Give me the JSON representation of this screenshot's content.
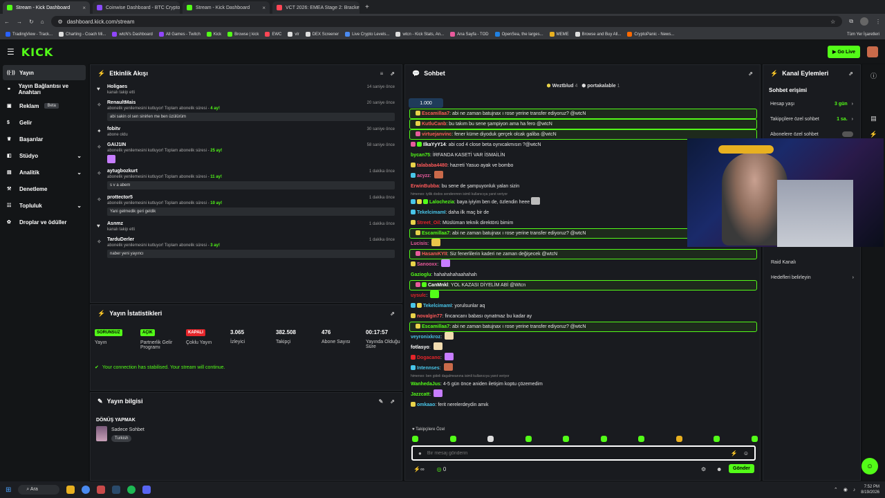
{
  "browser": {
    "tabs": [
      {
        "label": "Stream - Kick Dashboard",
        "color": "#53fc18",
        "active": true
      },
      {
        "label": "Coinwise Dashboard - BTC Crypto",
        "color": "#8a4bff",
        "active": false
      },
      {
        "label": "Stream - Kick Dashboard",
        "color": "#53fc18",
        "active": false
      },
      {
        "label": "VCT 2026: EMEA Stage 2: Brackets",
        "color": "#ff4655",
        "active": false
      }
    ],
    "url": "dashboard.kick.com/stream",
    "bookmarks": [
      "TradingView - Track...",
      "Charting - Coach Mi...",
      "wtcN's Dashboard",
      "All Games - Twitch",
      "Kick",
      "Browse | kick",
      "EWC",
      "vlr",
      "DEX Screener",
      "Live Crypto Levels...",
      "wtcn - Kick Stats, An...",
      "Ana Sayfa - TOD",
      "OpenSea, the larges...",
      "MEME",
      "Browse and Buy All...",
      "CryptoPanic - News..."
    ],
    "bookmarks_all": "Tüm Yer İşaretleri"
  },
  "header": {
    "logo": "KICK",
    "go_live": "Go Live"
  },
  "sidebar": {
    "items": [
      {
        "label": "Yayın",
        "icon": "broadcast-icon",
        "active": true,
        "chevron": false
      },
      {
        "label": "Yayın Bağlantısı ve Anahtarı",
        "icon": "link-icon",
        "active": false,
        "chevron": false
      },
      {
        "label": "Reklam",
        "icon": "ad-icon",
        "active": false,
        "chevron": false,
        "badge": "Beta"
      },
      {
        "label": "Gelir",
        "icon": "money-icon",
        "active": false,
        "chevron": false
      },
      {
        "label": "Başarılar",
        "icon": "trophy-icon",
        "active": false,
        "chevron": false
      },
      {
        "label": "Stüdyo",
        "icon": "studio-icon",
        "active": false,
        "chevron": true
      },
      {
        "label": "Analitik",
        "icon": "chart-icon",
        "active": false,
        "chevron": true
      },
      {
        "label": "Denetleme",
        "icon": "gavel-icon",
        "active": false,
        "chevron": false
      },
      {
        "label": "Topluluk",
        "icon": "community-icon",
        "active": false,
        "chevron": true
      },
      {
        "label": "Droplar ve ödüller",
        "icon": "gift-icon",
        "active": false,
        "chevron": false
      }
    ]
  },
  "activity": {
    "title": "Etkinlik Akışı",
    "items": [
      {
        "name": "Holigaes",
        "time": "14 saniye önce",
        "sub": "kanalı takip etti",
        "icon": "♥"
      },
      {
        "name": "RenaultMais",
        "time": "20 saniye önce",
        "sub": "abonelik yenilemesini kutluyor! Toplam abonelik süresi - ",
        "months": "4 ay!",
        "msg": "abi sakin ol sen sinirlen me ben üzülürüm",
        "icon": "✧"
      },
      {
        "name": "fobitv",
        "time": "30 saniye önce",
        "sub": "abone oldu",
        "icon": "✦"
      },
      {
        "name": "GAIJ1IN",
        "time": "58 saniye önce",
        "sub": "abonelik yenilemesini kutluyor! Toplam abonelik süresi - ",
        "months": "25 ay!",
        "emote": true,
        "icon": "✧"
      },
      {
        "name": "aytugbozkurt",
        "time": "1 dakika önce",
        "sub": "abonelik yenilemesini kutluyor! Toplam abonelik süresi - ",
        "months": "11 ay!",
        "msg": "s v a abem",
        "icon": "✧"
      },
      {
        "name": "prottector5",
        "time": "1 dakika önce",
        "sub": "abonelik yenilemesini kutluyor! Toplam abonelik süresi - ",
        "months": "10 ay!",
        "msg": "Yani gelmedik geri geldik",
        "icon": "✧"
      },
      {
        "name": "Asnmz",
        "time": "1 dakika önce",
        "sub": "kanalı takip etti",
        "icon": "♥"
      },
      {
        "name": "TarduDerler",
        "time": "1 dakika önce",
        "sub": "abonelik yenilemesini kutluyor! Toplam abonelik süresi - ",
        "months": "3 ay!",
        "msg": "naber yeni yayıncı",
        "icon": "✧"
      }
    ]
  },
  "stats": {
    "title": "Yayın İstatistikleri",
    "cols": [
      {
        "top": "SORUNSUZ",
        "label": "Yayın",
        "pill": "#53fc18"
      },
      {
        "top": "AÇIK",
        "label": "Partnerlik Gelir Programı",
        "pill": "#53fc18"
      },
      {
        "top": "KAPALI",
        "label": "Çoklu Yayın",
        "pill": "#e5252a"
      },
      {
        "top": "3.065",
        "label": "İzleyici"
      },
      {
        "top": "382.508",
        "label": "Takipçi"
      },
      {
        "top": "476",
        "label": "Abone Sayısı"
      },
      {
        "top": "00:17:57",
        "label": "Yayında Olduğu Süre"
      }
    ],
    "notice": "Your connection has stabilised. Your stream will continue."
  },
  "info": {
    "title": "Yayın bilgisi",
    "stream_title": "DÖNÜŞ YAPMAK",
    "category": "Sadece Sohbet",
    "lang": "Turkish"
  },
  "chat": {
    "title": "Sohbet",
    "mods": [
      {
        "name": "Weztblud",
        "count": "4"
      },
      {
        "name": "portakalable",
        "count": "1"
      }
    ],
    "goal": "1.000",
    "lines": [
      {
        "user": "Escamillaa7",
        "color": "#ff5a5a",
        "text": "abi ne zaman batujnax ı rose yerine transfer ediyoruz? @wtcN",
        "hl": true,
        "b": [
          "#e8d24a"
        ]
      },
      {
        "user": "KutluCanb",
        "color": "#ff5a5a",
        "text": "bu takım bu sene şampiyon ama ha fero @wtcN",
        "hl": true,
        "b": [
          "#e8d24a"
        ]
      },
      {
        "user": "virtuejanvinc",
        "color": "#ff5a5a",
        "text": "fener küme diyoduk gerçek olcak galiba @wtcN",
        "hl": true,
        "b": [
          "#e85a9c"
        ]
      },
      {
        "user": "IlkaYyY14",
        "color": "#ffffff",
        "text": "abi cod 4 close beta oynıcakmısın ?@wtcN",
        "hl": false,
        "b": [
          "#e85a9c",
          "#53fc18"
        ]
      },
      {
        "user": "bycan75",
        "color": "#53fc18",
        "text": "İRFANDA KASETİ VAR İSMAİLİN",
        "hl": false,
        "b": []
      },
      {
        "user": "talababa4480",
        "color": "#ff5a5a",
        "text": "hazreti Yasuo ayak ve bombo",
        "hl": false,
        "b": [
          "#e8d24a"
        ]
      },
      {
        "user": "acyzz",
        "color": "#e85a9c",
        "text": "",
        "hl": false,
        "b": [
          "#49c5e8"
        ],
        "emote": "#c96a4a"
      },
      {
        "user": "ErwinBubba",
        "color": "#ff5a5a",
        "text": "bu sene de şampuyonluk yalan sizin",
        "hl": false,
        "b": []
      },
      {
        "sys": "himenoo: iyilik dodos sendenmnn isimli kullanıcıya yanıt veriyor"
      },
      {
        "user": "Lalochezia",
        "color": "#53fc18",
        "text": "baya iyiyim ben de, özlendin heee",
        "hl": false,
        "b": [
          "#49c5e8",
          "#e8d24a",
          "#53fc18"
        ],
        "emote": "#bbb"
      },
      {
        "user": "TekelcimamI",
        "color": "#49c5e8",
        "text": "daha ilk maç bir de",
        "hl": false,
        "b": [
          "#49c5e8"
        ]
      },
      {
        "user": "Street_Oil",
        "color": "#e5252a",
        "text": "Müslüman teknik direktörü bimim",
        "hl": false,
        "b": [
          "#e8d24a"
        ]
      },
      {
        "user": "Escamillaa7",
        "color": "#53fc18",
        "text": "abi ne zaman batujnax ı rose yerine transfer ediyoruz? @wtcN",
        "hl": true,
        "b": [
          "#e8d24a"
        ]
      },
      {
        "user": "Lucisis",
        "color": "#e85a9c",
        "text": "",
        "hl": false,
        "b": [],
        "emote": "#e8c44a"
      },
      {
        "user": "HasanıKYII",
        "color": "#ff5a5a",
        "text": "Siz fenerlilerin kaderi ne zaman değişecek @wtcN",
        "hl": true,
        "b": [
          "#e85a9c"
        ]
      },
      {
        "user": "Sanooxx",
        "color": "#e85a9c",
        "text": "",
        "hl": false,
        "b": [
          "#e8d24a"
        ],
        "emote": "#c77dff"
      },
      {
        "user": "Gazioglu",
        "color": "#53fc18",
        "text": "hahahahahaahahah",
        "hl": false,
        "b": []
      },
      {
        "user": "CanMnkl",
        "color": "#ffffff",
        "text": "YOL KAZASI DİYELİM ABİ @Wtcn",
        "hl": true,
        "b": [
          "#e85a9c",
          "#53fc18"
        ]
      },
      {
        "user": "uysulc",
        "color": "#e5252a",
        "text": "",
        "hl": false,
        "b": [],
        "emote": "#53fc18"
      },
      {
        "user": "TekelcimamI",
        "color": "#49c5e8",
        "text": "yorulsunlar aq",
        "hl": false,
        "b": [
          "#49c5e8",
          "#e8d24a"
        ]
      },
      {
        "user": "novalgin77",
        "color": "#ff5a5a",
        "text": "fincancanı babası oynatmaz bu kadar ay",
        "hl": false,
        "b": [
          "#e8d24a"
        ]
      },
      {
        "user": "Escamillaa7",
        "color": "#53fc18",
        "text": "abi ne zaman batujnax ı rose yerine transfer ediyoruz? @wtcN",
        "hl": true,
        "b": [
          "#e8d24a"
        ]
      },
      {
        "user": "veyronixkroz",
        "color": "#49c5e8",
        "text": "",
        "hl": false,
        "b": [],
        "emote": "#f2dcb0"
      },
      {
        "user": "fotlasyo",
        "color": "#ffffff",
        "text": "",
        "hl": false,
        "b": [],
        "emote": "#f2dcb0"
      },
      {
        "user": "Dogacano",
        "color": "#e5252a",
        "text": "",
        "hl": false,
        "b": [
          "#e5252a"
        ],
        "emote": "#c77dff"
      },
      {
        "user": "Intennses",
        "color": "#49c5e8",
        "text": "",
        "hl": false,
        "b": [
          "#49c5e8"
        ],
        "emote": "#c96a4a"
      },
      {
        "sys": "himenoo: ben gideli dagalmeanına isimli kullanıcıya yanıt veriyor"
      },
      {
        "user": "WanhedaJus",
        "color": "#53fc18",
        "text": "4-5 gün önce aniden iletişim koptu çözemedim",
        "hl": false,
        "b": []
      },
      {
        "user": "Jazzcatt",
        "color": "#53fc18",
        "text": "",
        "hl": false,
        "b": [],
        "emote": "#c77dff"
      },
      {
        "user": "omkaao",
        "color": "#49c5e8",
        "text": "ferit nerelerdeydin amık",
        "hl": false,
        "b": [
          "#e8d24a"
        ]
      }
    ],
    "followers_only": "Takipçilere Özel",
    "placeholder": "Bir mesaj gönderin",
    "send": "Gönder",
    "points": "0"
  },
  "channel": {
    "title": "Kanal Eylemleri",
    "section": "Sohbet erişimi",
    "rows": [
      {
        "label": "Hesap yaşı",
        "value": "3 gün",
        "arrow": true
      },
      {
        "label": "Takipçilere özel sohbet",
        "value": "1 sa.",
        "arrow": true
      },
      {
        "label": "Abonelere özel sohbet",
        "value": "",
        "arrow": false
      }
    ],
    "bottom": [
      {
        "label": "Raid Kanalı",
        "arrow": false
      },
      {
        "label": "Hedefleri belirleyin",
        "arrow": true
      }
    ]
  },
  "taskbar": {
    "search": "Ara",
    "time": "7:52 PM",
    "date": "8/19/2026"
  }
}
